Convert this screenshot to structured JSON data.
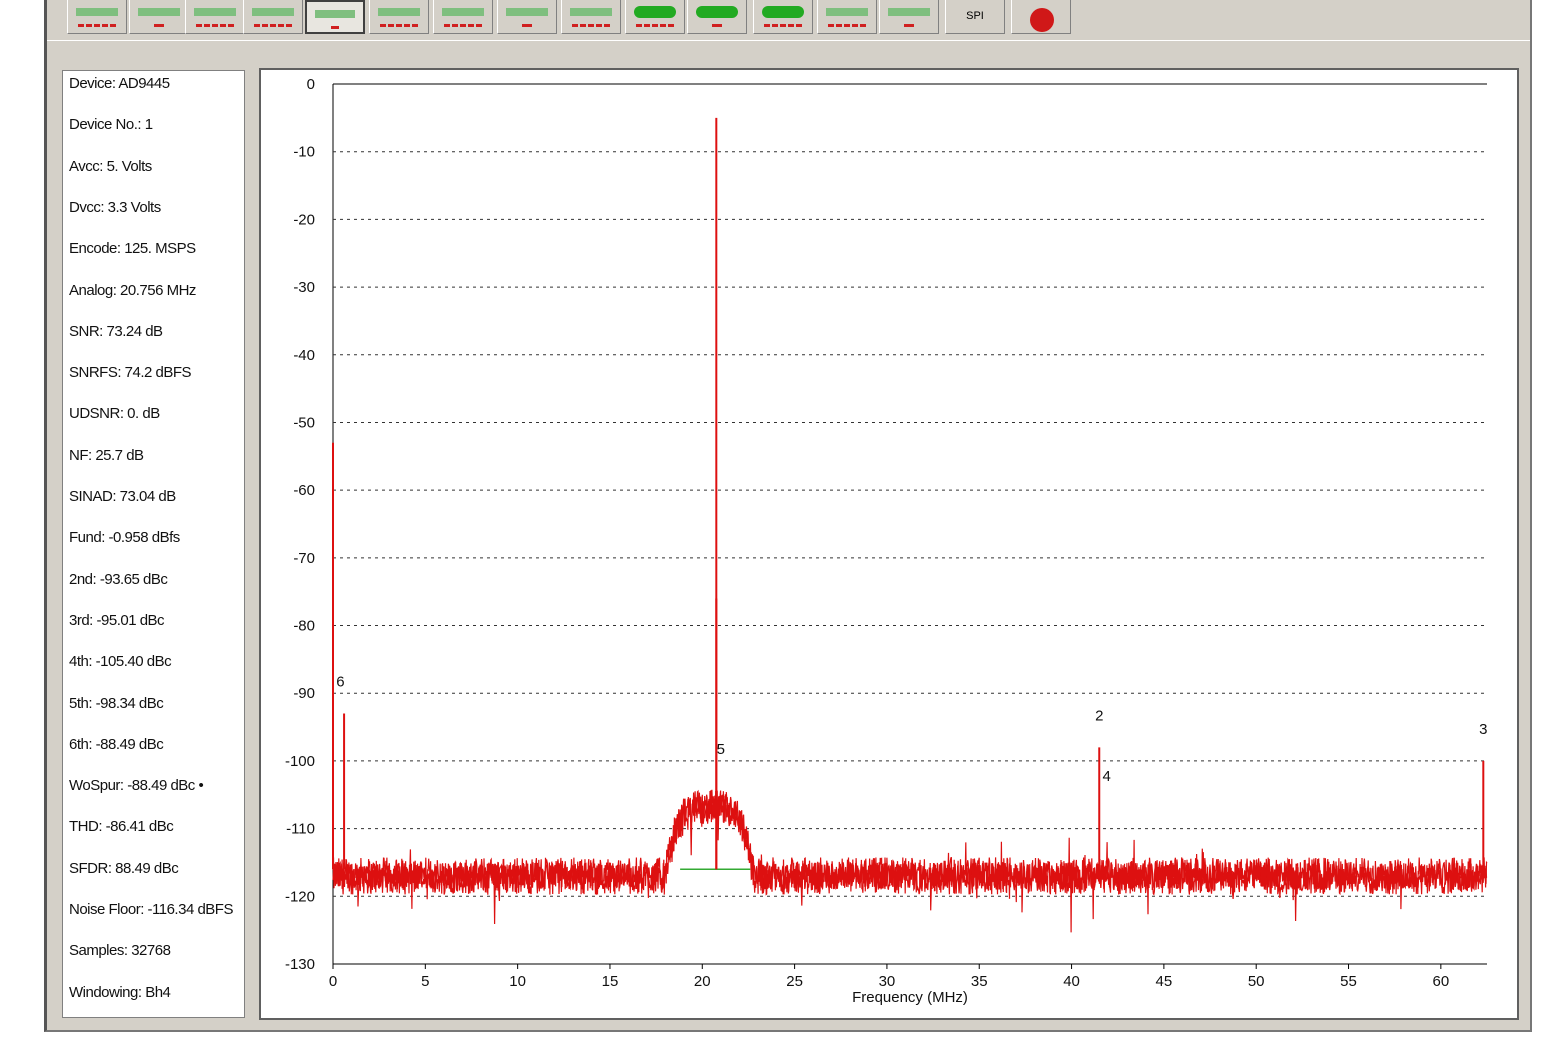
{
  "toolbar": {
    "buttons": [
      {
        "id": "tb1",
        "icon": "plot-icon",
        "label": ""
      },
      {
        "id": "tb2",
        "icon": "plot-icon",
        "label": ""
      },
      {
        "id": "tb3",
        "icon": "plot-icon",
        "label": ""
      },
      {
        "id": "tb4",
        "icon": "plot-icon",
        "label": ""
      },
      {
        "id": "tb5",
        "icon": "plot-icon",
        "label": ""
      },
      {
        "id": "tb6",
        "icon": "plot-icon",
        "label": ""
      },
      {
        "id": "tb7",
        "icon": "plot-icon",
        "label": ""
      },
      {
        "id": "tb8",
        "icon": "plot-icon",
        "label": ""
      },
      {
        "id": "tb9",
        "icon": "plot-icon",
        "label": ""
      },
      {
        "id": "tb10",
        "icon": "plot-icon",
        "label": ""
      },
      {
        "id": "tb11",
        "icon": "plot-icon",
        "label": ""
      },
      {
        "id": "tb12",
        "icon": "plot-icon",
        "label": ""
      },
      {
        "id": "tb13",
        "icon": "plot-icon",
        "label": ""
      },
      {
        "id": "tb14",
        "icon": "plot-icon",
        "label": ""
      },
      {
        "id": "tb15",
        "icon": "spi-icon",
        "label": "SPI"
      },
      {
        "id": "tb16",
        "icon": "stop-icon",
        "label": ""
      }
    ]
  },
  "info": [
    "Device: AD9445",
    "Device No.: 1",
    "Avcc: 5. Volts",
    "Dvcc: 3.3 Volts",
    "Encode: 125. MSPS",
    "Analog: 20.756 MHz",
    "SNR: 73.24 dB",
    "SNRFS: 74.2 dBFS",
    "UDSNR: 0. dB",
    "NF: 25.7 dB",
    "SINAD: 73.04 dB",
    "Fund: -0.958 dBfs",
    "2nd: -93.65 dBc",
    "3rd: -95.01 dBc",
    "4th: -105.40 dBc",
    "5th: -98.34 dBc",
    "6th: -88.49 dBc",
    "WoSpur: -88.49 dBc •",
    "THD: -86.41 dBc",
    "SFDR: 88.49 dBc",
    "Noise Floor: -116.34 dBFS",
    "Samples: 32768",
    "Windowing: Bh4"
  ],
  "colors": {
    "trace": "#dd1010",
    "noise_line": "#33aa33",
    "grid": "#333333",
    "axis": "#000000"
  },
  "chart_data": {
    "type": "line",
    "xlabel": "Frequency (MHz)",
    "ylabel": "",
    "xlim": [
      0,
      62.5
    ],
    "ylim": [
      -130,
      0
    ],
    "x_ticks": [
      "0",
      "5",
      "10",
      "15",
      "20",
      "25",
      "30",
      "35",
      "40",
      "45",
      "50",
      "55",
      "60"
    ],
    "y_ticks": [
      "0",
      "-10",
      "-20",
      "-30",
      "-40",
      "-50",
      "-60",
      "-70",
      "-80",
      "-90",
      "-100",
      "-110",
      "-120",
      "-130"
    ],
    "grid": "dotted horizontal",
    "noise_floor_dbfs": -116.34,
    "noise_line": {
      "x": [
        18.8,
        22.6
      ],
      "y": -116
    },
    "peaks": [
      {
        "x": 0.0,
        "y": -53
      },
      {
        "x": 0.6,
        "y": -93
      },
      {
        "x": 20.76,
        "y": -5
      },
      {
        "x": 20.76,
        "y": -76
      },
      {
        "x": 41.5,
        "y": -98
      },
      {
        "x": 62.3,
        "y": -100
      }
    ],
    "hump": {
      "x_range": [
        18.0,
        22.8
      ],
      "level": -107
    },
    "harmonic_labels": [
      {
        "text": "2",
        "x": 41.5,
        "y": -94
      },
      {
        "text": "3",
        "x": 62.3,
        "y": -96
      },
      {
        "text": "4",
        "x": 41.9,
        "y": -103
      },
      {
        "text": "5",
        "x": 21.0,
        "y": -99
      },
      {
        "text": "6",
        "x": 0.4,
        "y": -89
      }
    ]
  }
}
